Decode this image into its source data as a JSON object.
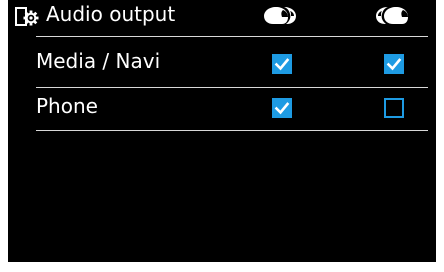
{
  "header": {
    "title": "Audio output",
    "title_icon": "audio-settings-icon",
    "columns": [
      {
        "icon": "helmet-rider-icon"
      },
      {
        "icon": "helmet-passenger-icon"
      }
    ]
  },
  "rows": [
    {
      "label": "Media / Navi",
      "rider": true,
      "passenger": true
    },
    {
      "label": "Phone",
      "rider": true,
      "passenger": false
    }
  ],
  "colors": {
    "background": "#000000",
    "text": "#ffffff",
    "checkbox": "#1e9be3",
    "divider": "#d8d8d8"
  }
}
